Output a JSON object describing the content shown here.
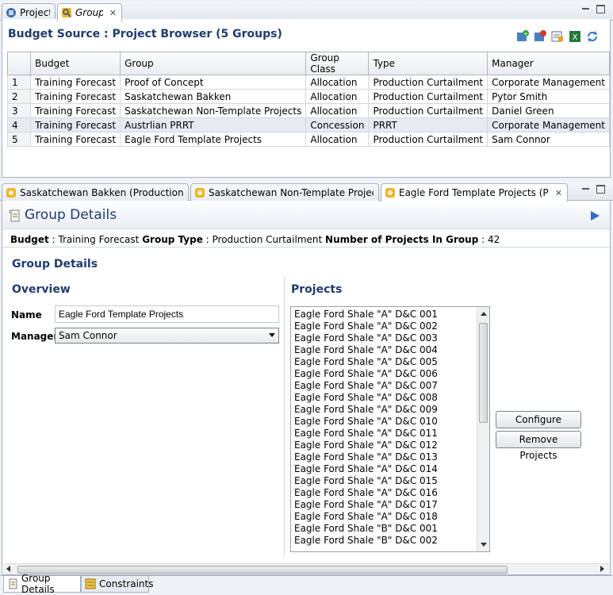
{
  "top_tabs": [
    {
      "label": "Projects",
      "icon": "projects-icon"
    },
    {
      "label": "Groups",
      "icon": "groups-icon"
    }
  ],
  "browser": {
    "title": "Budget Source : Project Browser (5 Groups)",
    "columns": [
      "",
      "Budget",
      "Group",
      "Group Class",
      "Type",
      "Manager"
    ],
    "rows": [
      {
        "n": "1",
        "budget": "Training Forecast",
        "group": "Proof of Concept",
        "group_class": "Allocation",
        "type": "Production Curtailment",
        "manager": "Corporate Management"
      },
      {
        "n": "2",
        "budget": "Training Forecast",
        "group": "Saskatchewan Bakken",
        "group_class": "Allocation",
        "type": "Production Curtailment",
        "manager": "Pytor Smith"
      },
      {
        "n": "3",
        "budget": "Training Forecast",
        "group": "Saskatchewan Non-Template Projects",
        "group_class": "Allocation",
        "type": "Production Curtailment",
        "manager": "Daniel Green"
      },
      {
        "n": "4",
        "budget": "Training Forecast",
        "group": "Austrlian PRRT",
        "group_class": "Concession",
        "type": "PRRT",
        "manager": "Corporate Management"
      },
      {
        "n": "5",
        "budget": "Training Forecast",
        "group": "Eagle Ford Template Projects",
        "group_class": "Allocation",
        "type": "Production Curtailment",
        "manager": "Sam Connor"
      }
    ],
    "selected_row": "4"
  },
  "editor_tabs": [
    {
      "label": "Saskatchewan Bakken (Production"
    },
    {
      "label": "Saskatchewan Non-Template Projec"
    },
    {
      "label": "Eagle Ford Template Projects (Prod"
    }
  ],
  "details": {
    "header_title": "Group Details",
    "info": {
      "budget_label": "Budget",
      "budget_value": "Training Forecast",
      "type_label": "Group Type",
      "type_value": "Production Curtailment",
      "count_label": "Number of Projects In Group",
      "count_value": "42"
    },
    "section_title": "Group Details",
    "overview_title": "Overview",
    "name_label": "Name",
    "name_value": "Eagle Ford Template Projects",
    "manager_label": "Manager",
    "manager_value": "Sam Connor",
    "projects_title": "Projects",
    "projects": [
      "Eagle Ford Shale \"A\" D&C 001",
      "Eagle Ford Shale \"A\" D&C 002",
      "Eagle Ford Shale \"A\" D&C 003",
      "Eagle Ford Shale \"A\" D&C 004",
      "Eagle Ford Shale \"A\" D&C 005",
      "Eagle Ford Shale \"A\" D&C 006",
      "Eagle Ford Shale \"A\" D&C 007",
      "Eagle Ford Shale \"A\" D&C 008",
      "Eagle Ford Shale \"A\" D&C 009",
      "Eagle Ford Shale \"A\" D&C 010",
      "Eagle Ford Shale \"A\" D&C 011",
      "Eagle Ford Shale \"A\" D&C 012",
      "Eagle Ford Shale \"A\" D&C 013",
      "Eagle Ford Shale \"A\" D&C 014",
      "Eagle Ford Shale \"A\" D&C 015",
      "Eagle Ford Shale \"A\" D&C 016",
      "Eagle Ford Shale \"A\" D&C 017",
      "Eagle Ford Shale \"A\" D&C 018",
      "Eagle Ford Shale \"B\" D&C 001",
      "Eagle Ford Shale \"B\" D&C 002"
    ],
    "configure_button": "Configure Projects",
    "remove_button": "Remove Projects"
  },
  "bottom_tabs": [
    {
      "label": "Group Details"
    },
    {
      "label": "Constraints"
    }
  ],
  "colors": {
    "heading": "#1f3c6e",
    "panel_border": "#a8b3c2",
    "selection": "#e6ebf3"
  }
}
